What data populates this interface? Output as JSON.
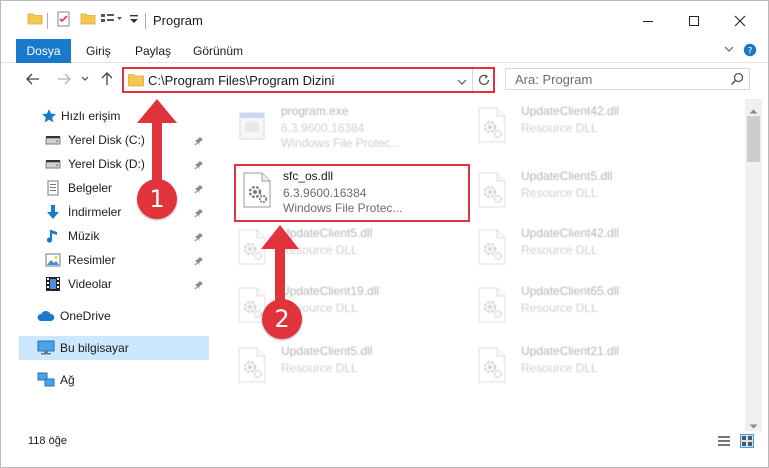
{
  "window": {
    "title": "Program",
    "controls": [
      "minimize-icon",
      "maximize-icon",
      "close-icon"
    ]
  },
  "ribbon": {
    "tabs": [
      "Dosya",
      "Giriş",
      "Paylaş",
      "Görünüm"
    ]
  },
  "navbar": {
    "address": "C:\\Program Files\\Program Dizini",
    "search_placeholder": "Ara: Program"
  },
  "sidebar": {
    "items": [
      {
        "label": "Hızlı erişim",
        "icon": "star-icon",
        "pinned": false
      },
      {
        "label": "Yerel Disk (C:)",
        "icon": "drive-icon",
        "pinned": true
      },
      {
        "label": "Yerel Disk (D:)",
        "icon": "drive-icon",
        "pinned": true
      },
      {
        "label": "Belgeler",
        "icon": "documents-icon",
        "pinned": true
      },
      {
        "label": "İndirmeler",
        "icon": "download-icon",
        "pinned": true
      },
      {
        "label": "Müzik",
        "icon": "music-icon",
        "pinned": true
      },
      {
        "label": "Resimler",
        "icon": "pictures-icon",
        "pinned": true
      },
      {
        "label": "Videolar",
        "icon": "videos-icon",
        "pinned": true
      },
      {
        "label": "OneDrive",
        "icon": "cloud-icon",
        "pinned": false
      },
      {
        "label": "Bu bilgisayar",
        "icon": "computer-icon",
        "pinned": false,
        "selected": true
      },
      {
        "label": "Ağ",
        "icon": "network-icon",
        "pinned": false
      }
    ]
  },
  "files": {
    "col1": [
      {
        "name": "program.exe",
        "version": "6.3.9600.16384",
        "desc": "Windows File Protec..."
      },
      {
        "name": "sfc_os.dll",
        "version": "6.3.9600.16384",
        "desc": "Windows File Protec..."
      },
      {
        "name": "UpdateClient5.dll",
        "version": "Resource DLL",
        "desc": ""
      },
      {
        "name": "UpdateClient19.dll",
        "version": "Resource DLL",
        "desc": ""
      },
      {
        "name": "UpdateClient5.dll",
        "version": "Resource DLL",
        "desc": ""
      }
    ],
    "col2": [
      {
        "name": "UpdateClient42.dll",
        "version": "Resource DLL",
        "desc": ""
      },
      {
        "name": "UpdateClient5.dll",
        "version": "Resource DLL",
        "desc": ""
      },
      {
        "name": "UpdateClient42.dll",
        "version": "Resource DLL",
        "desc": ""
      },
      {
        "name": "UpdateClient65.dll",
        "version": "Resource DLL",
        "desc": ""
      },
      {
        "name": "UpdateClient21.dll",
        "version": "Resource DLL",
        "desc": ""
      }
    ]
  },
  "status": {
    "count": "118 öğe"
  },
  "annotations": {
    "marker1": "1",
    "marker2": "2",
    "accent": "#e0333c"
  },
  "colors": {
    "file_tab": "#1979ca",
    "selection": "#cce8ff",
    "highlight": "#e0333c"
  }
}
